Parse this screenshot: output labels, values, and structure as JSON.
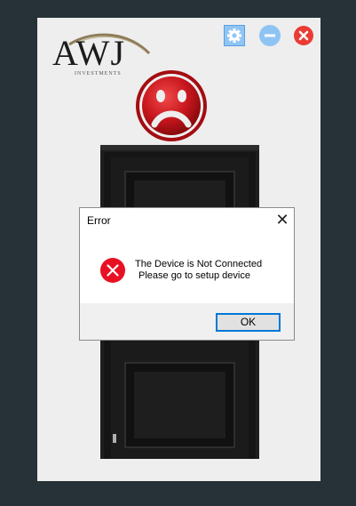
{
  "header": {
    "logo_text": "AWJ",
    "logo_subtext": "INVESTMENTS",
    "settings_icon": "gear-icon",
    "minimize_icon": "minus-icon",
    "close_icon": "close-icon"
  },
  "status_icon": "sad-face-icon",
  "illustration": "door",
  "dialog": {
    "title": "Error",
    "close_symbol": "✕",
    "icon": "error-icon",
    "message_line1": "The Device is Not Connected",
    "message_line2": "Please go to setup device",
    "ok_label": "OK"
  },
  "colors": {
    "background": "#263238",
    "window": "#eeeeee",
    "settings_button": "#8fc5f5",
    "minimize_button": "#8ec4f3",
    "close_button": "#ea3b34",
    "sad_face": "#c8161d",
    "door": "#1e1e1e",
    "error_icon": "#e81123",
    "ok_border": "#0078d7"
  }
}
